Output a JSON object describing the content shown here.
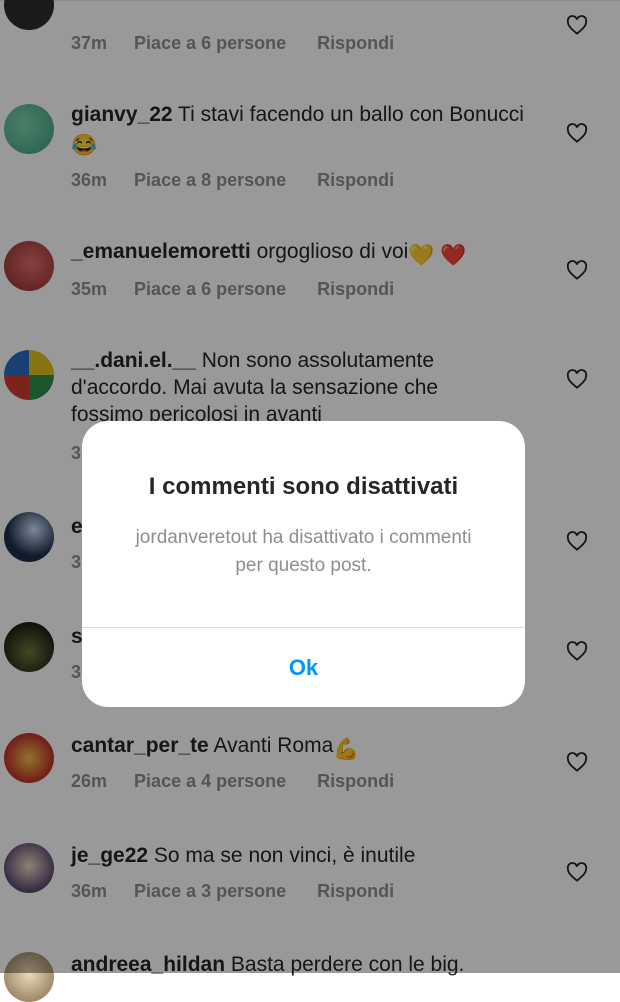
{
  "comments": [
    {
      "username": "",
      "text": "",
      "time": "37m",
      "likes": "Piace a 6 persone",
      "reply": "Rispondi"
    },
    {
      "username": "gianvy_22",
      "text": "Ti stavi facendo un  ballo con Bonucci",
      "emoji": "😂",
      "time": "36m",
      "likes": "Piace a 8 persone",
      "reply": "Rispondi"
    },
    {
      "username": "_emanuelemoretti",
      "text": "orgoglioso di voi",
      "emoji": "💛 ❤️",
      "time": "35m",
      "likes": "Piace a 6 persone",
      "reply": "Rispondi"
    },
    {
      "username": "__.dani.el.__",
      "text": "Non sono assolutamente d'accordo. Mai avuta la sensazione che fossimo pericolosi in avanti"
    },
    {
      "username": "e"
    },
    {
      "username": "s"
    },
    {
      "username": "cantar_per_te",
      "text": "Avanti Roma",
      "emoji": "💪",
      "time": "26m",
      "likes": "Piace a 4 persone",
      "reply": "Rispondi"
    },
    {
      "username": "je_ge22",
      "text": "So ma se non vinci, è inutile",
      "time": "36m",
      "likes": "Piace a 3 persone",
      "reply": "Rispondi"
    },
    {
      "username": "andreea_hildan",
      "text": "Basta perdere con le big."
    }
  ],
  "partial_times": [
    "3",
    "3",
    "3"
  ],
  "dialog": {
    "title": "I commenti sono disattivati",
    "message": "jordanveretout ha disattivato i commenti per questo post.",
    "ok_label": "Ok"
  },
  "colors": {
    "accent": "#0095f6",
    "meta_text": "#8e8e8e",
    "overlay": "rgba(0,0,0,0.40)"
  }
}
